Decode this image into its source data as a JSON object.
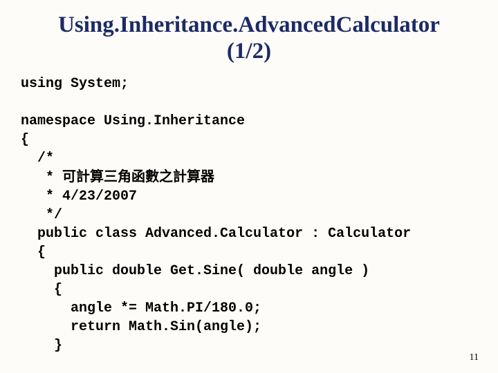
{
  "title_line1": "Using.Inheritance.AdvancedCalculator",
  "title_line2": "(1/2)",
  "code": {
    "l01": "using System;",
    "l02": "",
    "l03": "namespace Using.Inheritance",
    "l04": "{",
    "l05": "  /*",
    "l06a": "   * ",
    "l06b": "可計算三角函數之計算器",
    "l07": "   * 4/23/2007",
    "l08": "   */",
    "l09": "  public class Advanced.Calculator : Calculator",
    "l10": "  {",
    "l11": "    public double Get.Sine( double angle )",
    "l12": "    {",
    "l13": "      angle *= Math.PI/180.0;",
    "l14": "      return Math.Sin(angle);",
    "l15": "    }"
  },
  "page_number": "11"
}
